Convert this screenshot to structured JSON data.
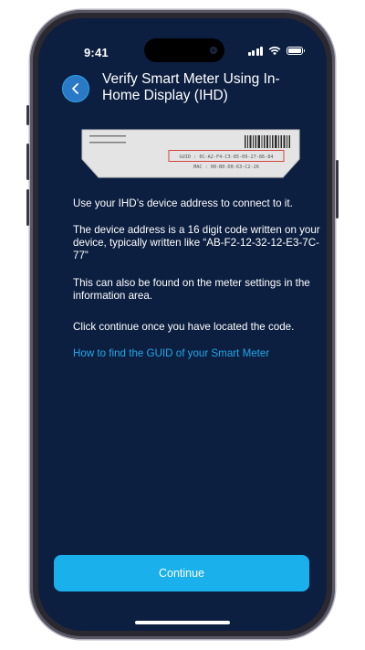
{
  "status_bar": {
    "time": "9:41"
  },
  "header": {
    "back_icon": "chevron-left-icon",
    "title": "Verify Smart Meter Using In-Home Display (IHD)"
  },
  "device_label": {
    "guid": "GUID : 0C-A2-F4-C3-85-09-27-86-84",
    "mac": "MAC : 00-B0-D0-63-C2-26"
  },
  "content": {
    "paragraphs": [
      "Use your IHD’s device address to connect to it.",
      "The device address is a 16 digit code written on your device, typically written like “AB-F2-12-32-12-E3-7C-77”",
      "This can also be found on the meter settings in the information area.",
      "Click continue once you have located the code."
    ],
    "help_link": "How to find the GUID of your Smart Meter"
  },
  "footer": {
    "continue_label": "Continue"
  },
  "colors": {
    "background": "#0c1f40",
    "accent": "#1ab0ec",
    "link": "#1fa8e8",
    "highlight_box": "#d2463f"
  }
}
